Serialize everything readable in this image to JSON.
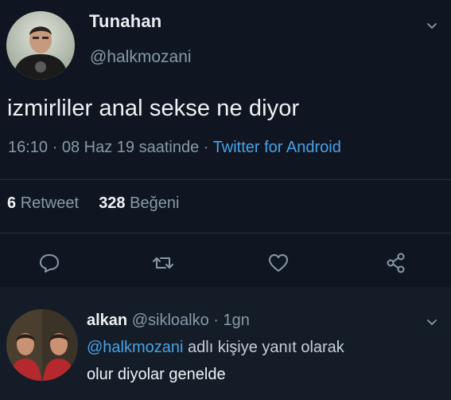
{
  "tweet": {
    "author_name": "Tunahan",
    "author_handle": "@halkmozani",
    "text": "izmirliler anal sekse ne diyor",
    "time": "16:10",
    "date": "08 Haz 19 saatinde",
    "source": "Twitter for Android",
    "separator": "·",
    "retweets_count": "6",
    "retweets_label": "Retweet",
    "likes_count": "328",
    "likes_label": "Beğeni",
    "actions": [
      "reply-icon",
      "retweet-icon",
      "heart-icon",
      "share-icon"
    ]
  },
  "reply": {
    "author_name": "alkan",
    "author_handle": "@sikloalko",
    "separator": "·",
    "time": "1gn",
    "mention": "@halkmozani",
    "reply_to_suffix": "adlı kişiye yanıt olarak",
    "text": "olur diyolar genelde"
  },
  "colors": {
    "background": "#0f1622",
    "accent": "#4aa3e6",
    "secondary_text": "#8899a6",
    "divider": "#263340"
  }
}
